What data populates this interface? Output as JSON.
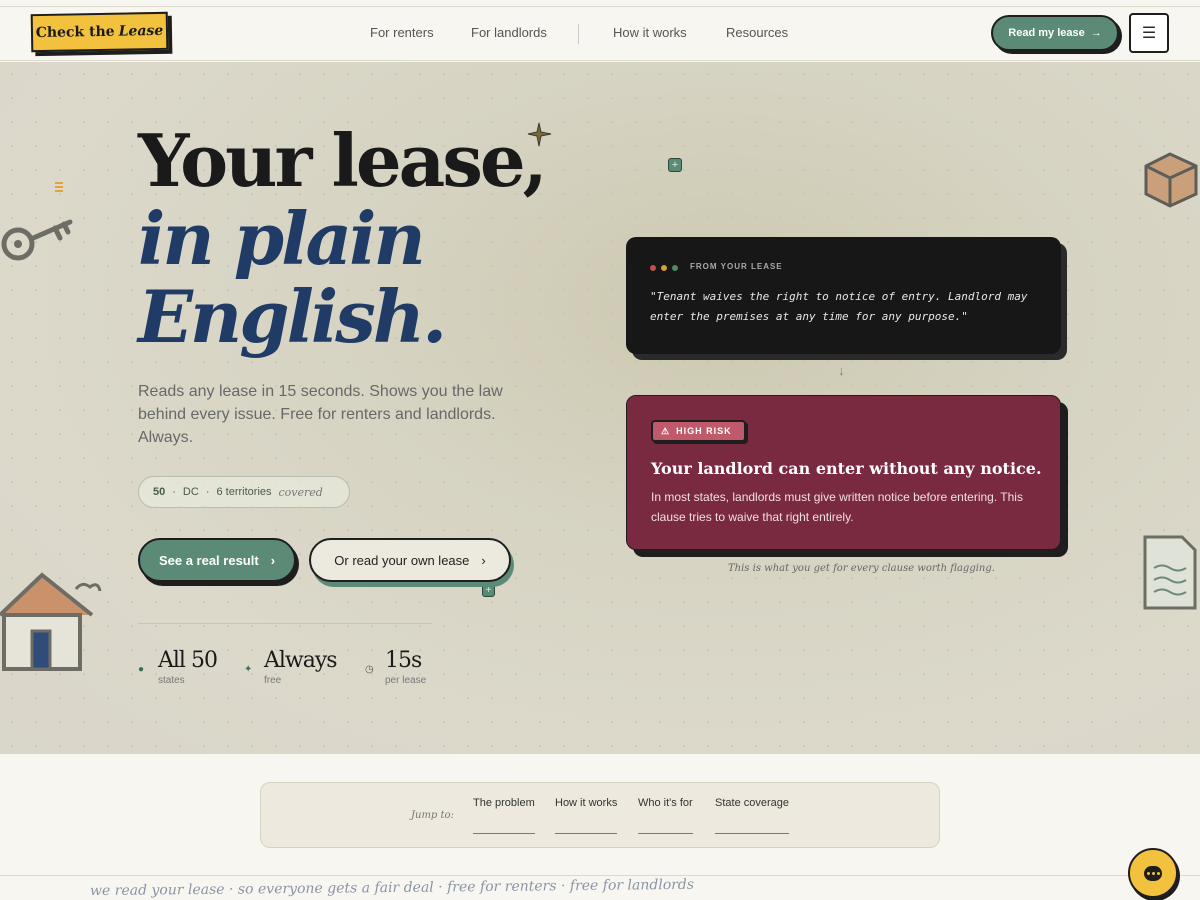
{
  "brand": {
    "logo_text": "Check the",
    "logo_em": "Lease"
  },
  "nav": {
    "items": [
      "For renters",
      "For landlords",
      "How it works",
      "Resources"
    ],
    "cta_label": "Read my lease",
    "cta_arrow": "→",
    "menu_icon": "☰"
  },
  "hero": {
    "title_line1": "Your lease,",
    "title_line2": "in plain",
    "title_line3": "English.",
    "subtitle": "Reads any lease in 15 seconds. Shows you the law behind every issue. Free for renters and landlords. Always.",
    "coverage": {
      "states": "50",
      "dc": "DC",
      "territories": "6 territories",
      "suffix": "covered"
    },
    "primary_button": "See a real result",
    "secondary_button": "Or read your own lease",
    "chevron": "›",
    "stats": [
      {
        "value": "All 50",
        "label": "states"
      },
      {
        "value": "Always",
        "label": "free"
      },
      {
        "value": "15s",
        "label": "per lease"
      }
    ]
  },
  "example": {
    "source_label": "FROM YOUR LEASE",
    "quote": "\"Tenant waives the right to notice of entry. Landlord may enter the premises at any time for any purpose.\"",
    "risk_badge": "HIGH RISK",
    "risk_title": "Your landlord can enter without any notice.",
    "risk_description": "In most states, landlords must give written notice before entering. This clause tries to waive that right entirely.",
    "caption": "This is what you get for every clause worth flagging."
  },
  "jump": {
    "label": "Jump to:",
    "links": [
      "The problem",
      "How it works",
      "Who it's for",
      "State coverage"
    ]
  },
  "marquee": "we read your lease · so everyone gets a fair deal · free for renters · free for landlords",
  "colors": {
    "accent_green": "#5b8a77",
    "brand_yellow": "#f2c13d",
    "risk_red": "#7a2a40",
    "navy": "#1f3b66"
  }
}
